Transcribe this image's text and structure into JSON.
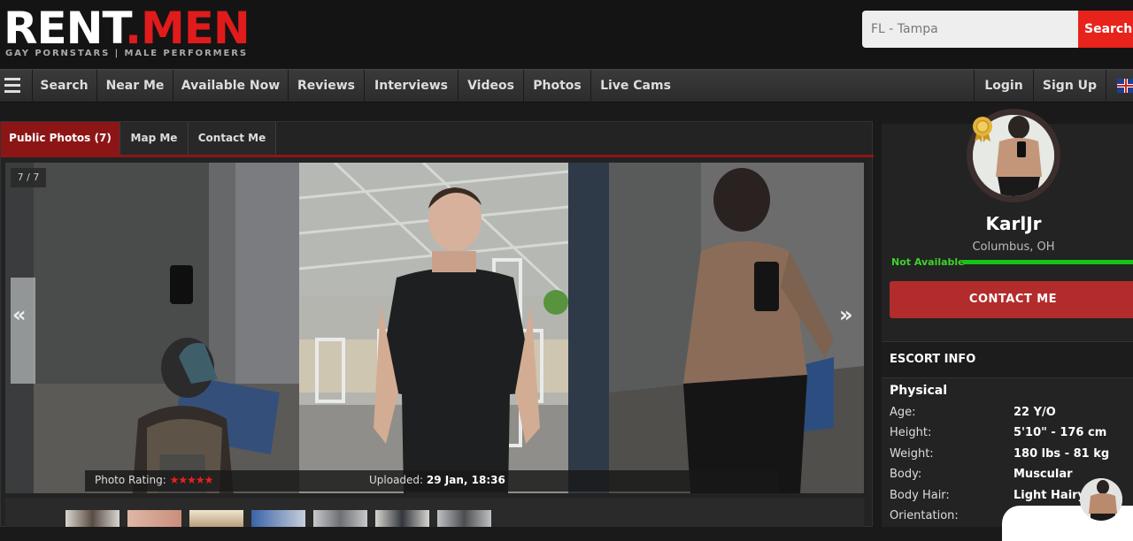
{
  "header": {
    "logo_rent": "RENT",
    "logo_dot": ".",
    "logo_men": "MEN",
    "logo_tagline": "GAY PORNSTARS | MALE PERFORMERS",
    "search_placeholder": "FL - Tampa",
    "search_button": "Search"
  },
  "nav": {
    "menu_icon": "hamburger-icon",
    "items": [
      "Search",
      "Near Me",
      "Available Now",
      "Reviews",
      "Interviews",
      "Videos",
      "Photos",
      "Live Cams"
    ],
    "login": "Login",
    "signup": "Sign Up",
    "language_icon": "uk-flag-icon"
  },
  "tabs": [
    "Public Photos (7)",
    "Map Me",
    "Contact Me"
  ],
  "gallery": {
    "counter": "7 / 7",
    "prev_icon": "«",
    "next_icon": "»",
    "rating_label": "Photo Rating:",
    "rating_stars": "★★★★★",
    "rating_value": 5,
    "uploaded_label": "Uploaded:",
    "uploaded_value": "29 Jan, 18:36"
  },
  "profile": {
    "name": "KarlJr",
    "location": "Columbus, OH",
    "availability": "Not Available",
    "contact_button": "CONTACT ME",
    "info_heading": "ESCORT INFO",
    "section_title": "Physical",
    "fields": [
      {
        "label": "Age:",
        "value": "22 Y/O"
      },
      {
        "label": "Height:",
        "value": "5'10\" - 176 cm"
      },
      {
        "label": "Weight:",
        "value": "180 lbs - 81 kg"
      },
      {
        "label": "Body:",
        "value": "Muscular"
      },
      {
        "label": "Body Hair:",
        "value": "Light Hairy"
      },
      {
        "label": "Orientation:",
        "value": ""
      }
    ]
  },
  "colors": {
    "brand_red": "#e01b1b",
    "tab_active": "#8c1616",
    "contact_button": "#b32c2c",
    "available_green": "#17c317"
  }
}
